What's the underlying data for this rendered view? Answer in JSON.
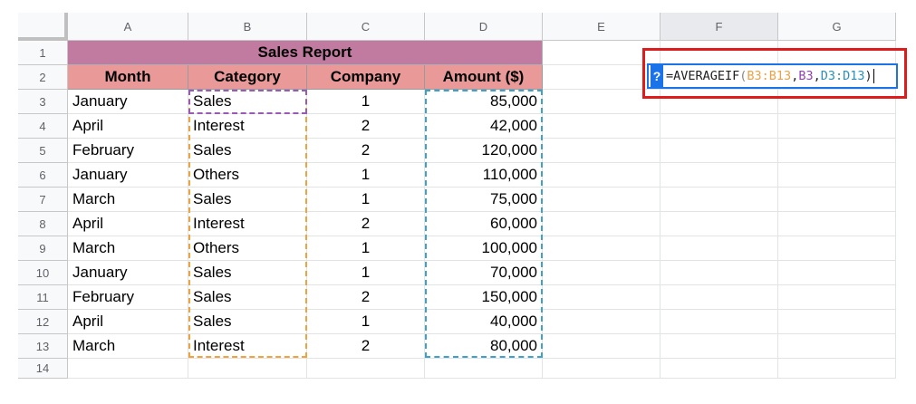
{
  "columns": [
    "A",
    "B",
    "C",
    "D",
    "E",
    "F",
    "G"
  ],
  "rows": [
    "1",
    "2",
    "3",
    "4",
    "5",
    "6",
    "7",
    "8",
    "9",
    "10",
    "11",
    "12",
    "13",
    "14"
  ],
  "title": "Sales Report",
  "headers": {
    "month": "Month",
    "category": "Category",
    "company": "Company",
    "amount": "Amount ($)"
  },
  "data": [
    {
      "month": "January",
      "category": "Sales",
      "company": "1",
      "amount": "85,000"
    },
    {
      "month": "April",
      "category": "Interest",
      "company": "2",
      "amount": "42,000"
    },
    {
      "month": "February",
      "category": "Sales",
      "company": "2",
      "amount": "120,000"
    },
    {
      "month": "January",
      "category": "Others",
      "company": "1",
      "amount": "110,000"
    },
    {
      "month": "March",
      "category": "Sales",
      "company": "1",
      "amount": "75,000"
    },
    {
      "month": "April",
      "category": "Interest",
      "company": "2",
      "amount": "60,000"
    },
    {
      "month": "March",
      "category": "Others",
      "company": "1",
      "amount": "100,000"
    },
    {
      "month": "January",
      "category": "Sales",
      "company": "1",
      "amount": "70,000"
    },
    {
      "month": "February",
      "category": "Sales",
      "company": "2",
      "amount": "150,000"
    },
    {
      "month": "April",
      "category": "Sales",
      "company": "1",
      "amount": "40,000"
    },
    {
      "month": "March",
      "category": "Interest",
      "company": "2",
      "amount": "80,000"
    }
  ],
  "editor": {
    "help_badge": "?",
    "formula_prefix": "=AVERAGEIF",
    "open_paren": "(",
    "arg1": "B3:B13",
    "comma1": ",",
    "arg2": "B3",
    "comma2": ",",
    "arg3": "D3:D13",
    "close_paren": ")"
  },
  "colors": {
    "title_fill": "#c27ba0",
    "header_fill": "#ea9999",
    "range_category": "#f0a23d",
    "criterion": "#9b59b6",
    "range_amount": "#3ea1c9",
    "callout": "#e01b1b",
    "editor_border": "#1a73e8"
  }
}
